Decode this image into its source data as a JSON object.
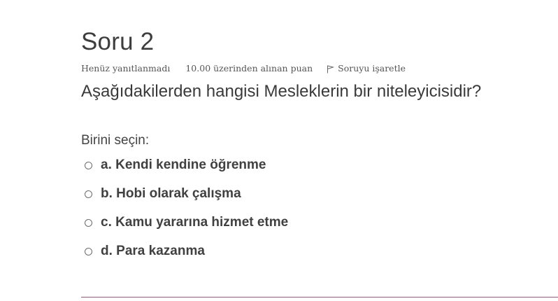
{
  "question": {
    "title": "Soru 2",
    "status": "Henüz yanıtlanmadı",
    "grade": "10.00 üzerinden alınan puan",
    "flag_label": "Soruyu işaretle",
    "flag_icon": "flag-icon",
    "text": "Aşağıdakilerden hangisi Mesleklerin bir niteleyicisidir?",
    "prompt": "Birini seçin:",
    "answers": [
      {
        "label": "a. Kendi kendine öğrenme",
        "selected": false
      },
      {
        "label": "b. Hobi olarak çalışma",
        "selected": false
      },
      {
        "label": "c. Kamu yararına hizmet etme",
        "selected": false
      },
      {
        "label": "d. Para kazanma",
        "selected": false
      }
    ]
  },
  "colors": {
    "divider": "#8a5a78",
    "text": "#373a3c"
  }
}
